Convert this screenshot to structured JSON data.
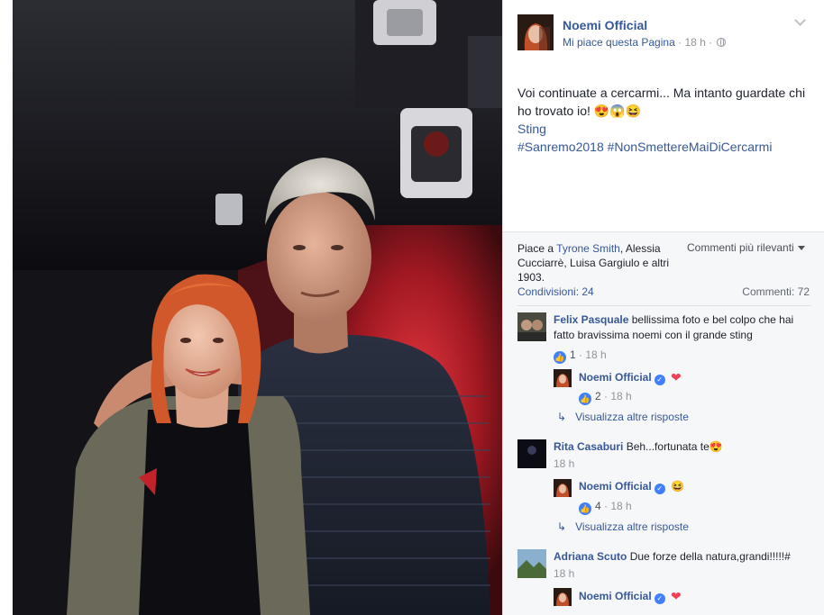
{
  "post": {
    "page_name": "Noemi Official",
    "like_page": "Mi piace questa Pagina",
    "time": "18 h",
    "text": "Voi continuate a cercarmi... Ma intanto guardate chi ho trovato io!",
    "text_emojis": "😍😱😆",
    "tag": "Sting",
    "hashtags": "#Sanremo2018 #NonSmettereMaiDiCercarmi"
  },
  "stats": {
    "likes_prefix": "Piace a",
    "likes_name": "Tyrone Smith",
    "likes_rest": ", Alessia Cucciarrè, Luisa Gargiulo e altri 1903.",
    "sort_label": "Commenti più rilevanti",
    "shares": "Condivisioni: 24",
    "comments": "Commenti: 72"
  },
  "comments": [
    {
      "name": "Felix Pasquale",
      "text": "bellissima foto e bel colpo che hai fatto bravissima noemi con il grande sting",
      "likes": "1",
      "time": "18 h",
      "reply": {
        "name": "Noemi Official",
        "emoji": "❤",
        "likes": "2",
        "time": "18 h"
      },
      "more": "Visualizza altre risposte"
    },
    {
      "name": "Rita Casaburi",
      "text": "Beh...fortunata te",
      "emoji": "😍",
      "time": "18 h",
      "reply": {
        "name": "Noemi Official",
        "emoji": "😆",
        "likes": "4",
        "time": "18 h"
      },
      "more": "Visualizza altre risposte"
    },
    {
      "name": "Adriana Scuto",
      "text": "Due forze della natura,grandi!!!!!#",
      "time": "18 h",
      "reply": {
        "name": "Noemi Official",
        "emoji": "❤"
      }
    }
  ],
  "icons": {
    "chevron": "chevron-down-icon",
    "globe": "globe-icon",
    "thumb": "like-thumb-icon",
    "verified": "verified-badge-icon",
    "reply_arrow": "reply-arrow-icon"
  },
  "colors": {
    "link": "#365899",
    "like_blue": "#4080ff",
    "heart": "#f33e58",
    "meta_gray": "#90949c"
  }
}
